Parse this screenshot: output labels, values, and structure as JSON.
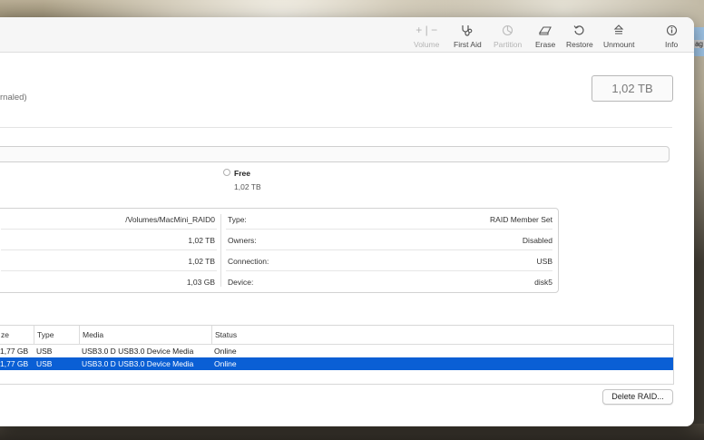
{
  "toolbar": {
    "volume_label": "Volume",
    "first_aid_label": "First Aid",
    "partition_label": "Partition",
    "erase_label": "Erase",
    "restore_label": "Restore",
    "unmount_label": "Unmount",
    "info_label": "Info",
    "plus_glyph": "+",
    "minus_glyph": "−"
  },
  "header": {
    "subtitle_fragment": "rnaled)",
    "capacity": "1,02 TB"
  },
  "usage": {
    "free_label": "Free",
    "free_value": "1,02 TB"
  },
  "info": {
    "left": [
      {
        "value": "/Volumes/MacMini_RAID0"
      },
      {
        "value": "1,02 TB"
      },
      {
        "value": "1,02 TB"
      },
      {
        "value": "1,03 GB"
      }
    ],
    "right": [
      {
        "label": "Type:",
        "value": "RAID Member Set"
      },
      {
        "label": "Owners:",
        "value": "Disabled"
      },
      {
        "label": "Connection:",
        "value": "USB"
      },
      {
        "label": "Device:",
        "value": "disk5"
      }
    ]
  },
  "members": {
    "columns": [
      "ze",
      "Type",
      "Media",
      "Status"
    ],
    "rows": [
      {
        "size": "1,77 GB",
        "type": "USB",
        "media": "USB3.0 D USB3.0 Device Media",
        "status": "Online",
        "selected": false
      },
      {
        "size": "1,77 GB",
        "type": "USB",
        "media": "USB3.0 D USB3.0 Device Media",
        "status": "Online",
        "selected": true
      }
    ]
  },
  "actions": {
    "delete_raid_label": "Delete RAID..."
  },
  "desktop": {
    "right_tag": "ag"
  },
  "colors": {
    "selection": "#0a5fd5",
    "window_bg": "#ffffff",
    "toolbar_bg": "#f6f6f6"
  }
}
